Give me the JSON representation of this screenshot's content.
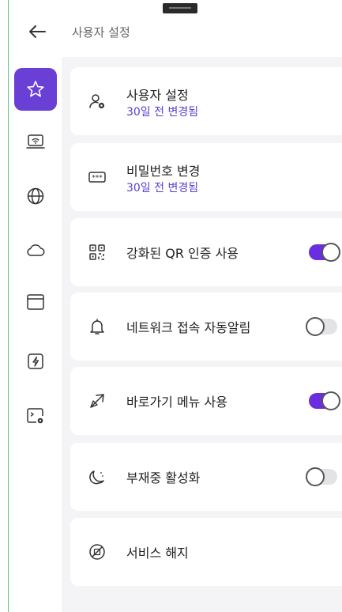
{
  "header": {
    "title": "사용자 설정"
  },
  "sidebar": {
    "items": [
      {
        "icon": "star-icon",
        "active": true
      },
      {
        "icon": "laptop-wifi-icon",
        "active": false
      },
      {
        "icon": "globe-icon",
        "active": false
      },
      {
        "icon": "cloud-icon",
        "active": false
      },
      {
        "icon": "browser-window-icon",
        "active": false
      },
      {
        "icon": "flash-card-icon",
        "active": false
      },
      {
        "icon": "terminal-settings-icon",
        "active": false
      }
    ]
  },
  "settings": {
    "user_settings": {
      "label": "사용자 설정",
      "sub": "30일 전 변경됨",
      "icon": "user-gear-icon"
    },
    "change_password": {
      "label": "비밀번호 변경",
      "sub": "30일 전 변경됨",
      "icon": "password-icon"
    },
    "qr_auth": {
      "label": "강화된 QR 인증 사용",
      "icon": "qr-code-icon",
      "enabled": true
    },
    "network_alert": {
      "label": "네트워크 접속 자동알림",
      "icon": "bell-icon",
      "enabled": false
    },
    "shortcut_menu": {
      "label": "바로가기 메뉴 사용",
      "icon": "shortcut-arrow-icon",
      "enabled": true
    },
    "away_mode": {
      "label": "부재중 활성화",
      "icon": "moon-icon",
      "enabled": false
    },
    "cancel_service": {
      "label": "서비스 해지",
      "icon": "prohibited-icon"
    }
  },
  "colors": {
    "accent": "#6a2ee0",
    "sidebar_active": "#6a3fd6",
    "border": "#5cc58a",
    "background": "#f4f4f6"
  }
}
